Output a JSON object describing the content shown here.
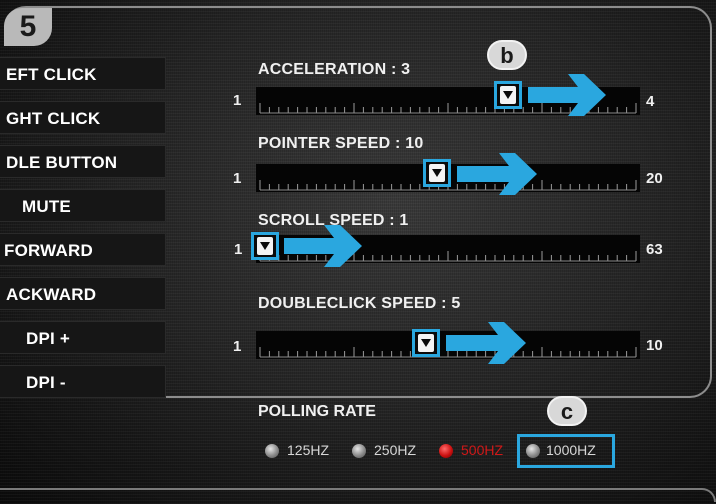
{
  "step_badge": "5",
  "button_list": [
    {
      "label": "EFT CLICK"
    },
    {
      "label": "GHT CLICK"
    },
    {
      "label": "DLE BUTTON"
    },
    {
      "label": "MUTE"
    },
    {
      "label": "FORWARD"
    },
    {
      "label": "ACKWARD"
    },
    {
      "label": "DPI +"
    },
    {
      "label": "DPI -"
    }
  ],
  "sliders": [
    {
      "label": "ACCELERATION : 3",
      "min": "1",
      "max": "4",
      "value": 3
    },
    {
      "label": "POINTER SPEED : 10",
      "min": "1",
      "max": "20",
      "value": 10
    },
    {
      "label": "SCROLL SPEED : 1",
      "min": "1",
      "max": "63",
      "value": 1
    },
    {
      "label": "DOUBLECLICK SPEED : 5",
      "min": "1",
      "max": "10",
      "value": 5
    }
  ],
  "annotation_markers": {
    "b": "b",
    "c": "c"
  },
  "polling_rate": {
    "title": "POLLING RATE",
    "options": [
      {
        "label": "125HZ",
        "state": "off"
      },
      {
        "label": "250HZ",
        "state": "off"
      },
      {
        "label": "500HZ",
        "state": "current"
      },
      {
        "label": "1000HZ",
        "state": "off"
      }
    ]
  },
  "colors": {
    "highlight": "#2aa7df",
    "active_red": "#cc1111",
    "panel": "#161616"
  }
}
